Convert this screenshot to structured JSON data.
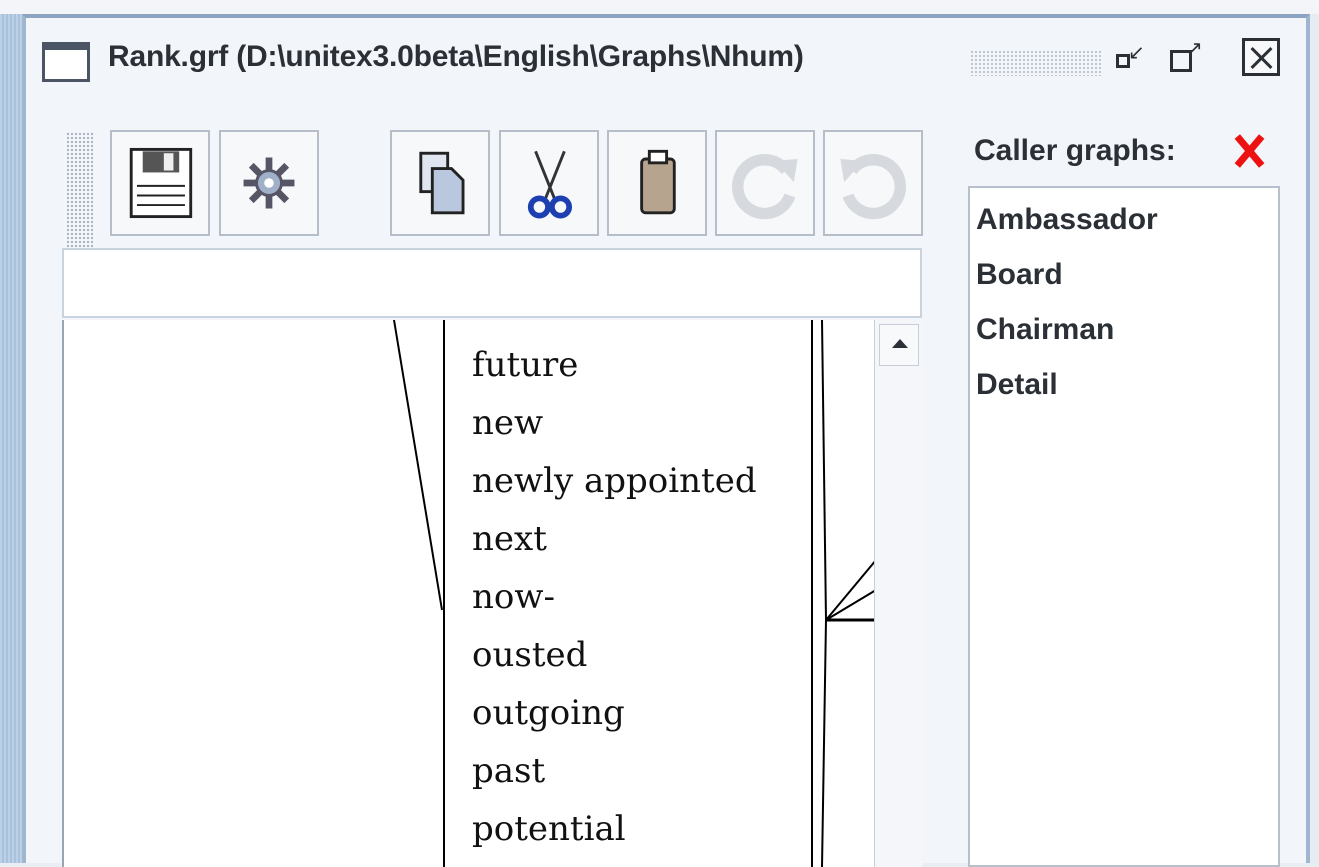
{
  "window": {
    "title": "Rank.grf (D:\\unitex3.0beta\\English\\Graphs\\Nhum)"
  },
  "toolbar": {
    "tools": [
      {
        "id": "save",
        "icon": "floppy-disk-icon"
      },
      {
        "id": "compile",
        "icon": "gear-icon"
      },
      {
        "id": "copy",
        "icon": "copy-icon"
      },
      {
        "id": "cut",
        "icon": "scissors-icon"
      },
      {
        "id": "paste",
        "icon": "clipboard-icon"
      },
      {
        "id": "redo",
        "icon": "redo-icon",
        "enabled": false
      },
      {
        "id": "undo",
        "icon": "undo-icon",
        "enabled": false
      }
    ]
  },
  "box_input": {
    "value": ""
  },
  "graph": {
    "box_entries": [
      "future",
      "new",
      "newly appointed",
      "next",
      "now-",
      "ousted",
      "outgoing",
      "past",
      "potential"
    ]
  },
  "caller_graphs": {
    "label": "Caller graphs:",
    "items": [
      "Ambassador",
      "Board",
      "Chairman",
      "Detail"
    ]
  },
  "colors": {
    "close_x": "#e11111",
    "frame": "#8aa4c1",
    "text": "#2b2f36"
  }
}
